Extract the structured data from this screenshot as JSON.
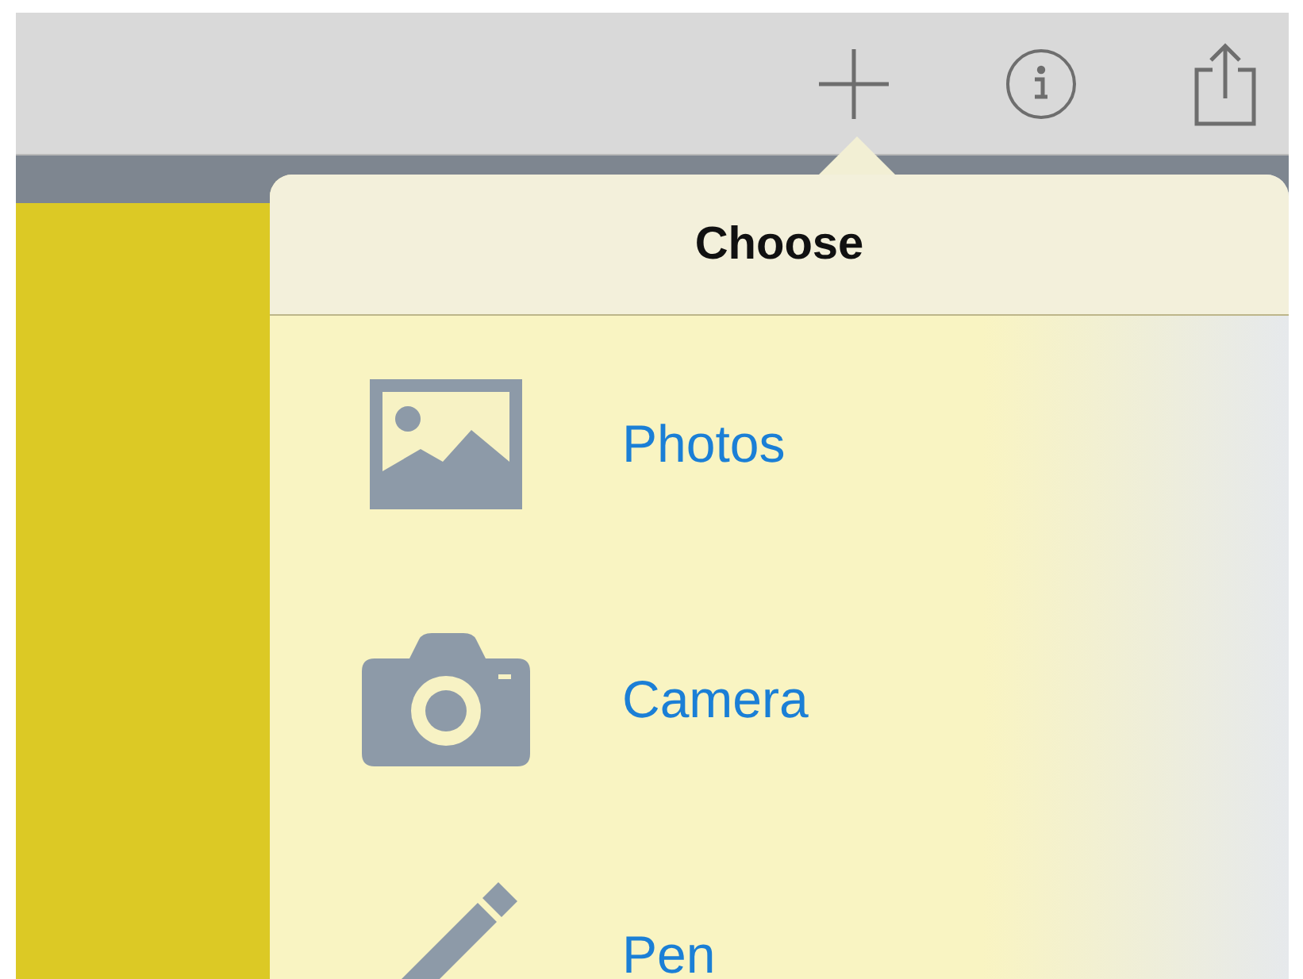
{
  "popover": {
    "title": "Choose",
    "items": [
      {
        "label": "Photos",
        "kind": "photos"
      },
      {
        "label": "Camera",
        "kind": "camera"
      },
      {
        "label": "Pen",
        "kind": "pen"
      }
    ]
  }
}
